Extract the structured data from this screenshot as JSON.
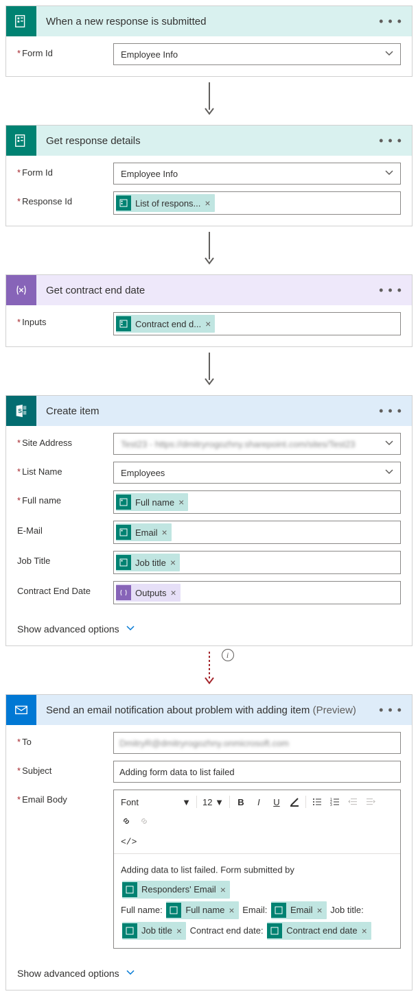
{
  "cards": {
    "trigger": {
      "title": "When a new response is submitted",
      "formId": {
        "label": "Form Id",
        "value": "Employee Info"
      }
    },
    "getDetails": {
      "title": "Get response details",
      "formId": {
        "label": "Form Id",
        "value": "Employee Info"
      },
      "responseId": {
        "label": "Response Id",
        "token": "List of respons..."
      }
    },
    "getDate": {
      "title": "Get contract end date",
      "inputs": {
        "label": "Inputs",
        "token": "Contract end d..."
      }
    },
    "createItem": {
      "title": "Create item",
      "siteAddress": {
        "label": "Site Address",
        "value": "Test23 - https://dmitryrogozhny.sharepoint.com/sites/Test23"
      },
      "listName": {
        "label": "List Name",
        "value": "Employees"
      },
      "fullName": {
        "label": "Full name",
        "token": "Full name"
      },
      "email": {
        "label": "E-Mail",
        "token": "Email"
      },
      "jobTitle": {
        "label": "Job Title",
        "token": "Job title"
      },
      "endDate": {
        "label": "Contract End Date",
        "token": "Outputs"
      },
      "advanced": "Show advanced options"
    },
    "email": {
      "title": "Send an email notification about problem with adding item",
      "preview": "(Preview)",
      "to": {
        "label": "To",
        "value": "DmitryR@dmitryrogozhny.onmicrosoft.com"
      },
      "subject": {
        "label": "Subject",
        "value": "Adding form data to list failed"
      },
      "body": {
        "label": "Email Body"
      },
      "toolbar": {
        "font": "Font",
        "size": "12"
      },
      "bodyText": {
        "line1a": "Adding data to list failed. Form submitted by",
        "token1": "Responders' Email",
        "fullLabel": "Full name:",
        "fullToken": "Full name",
        "emailLabel": "Email:",
        "emailToken": "Email",
        "jobLabel": "Job title:",
        "jobToken": "Job title",
        "dateLabel": "Contract end date:",
        "dateToken": "Contract end date"
      },
      "advanced": "Show advanced options"
    }
  }
}
